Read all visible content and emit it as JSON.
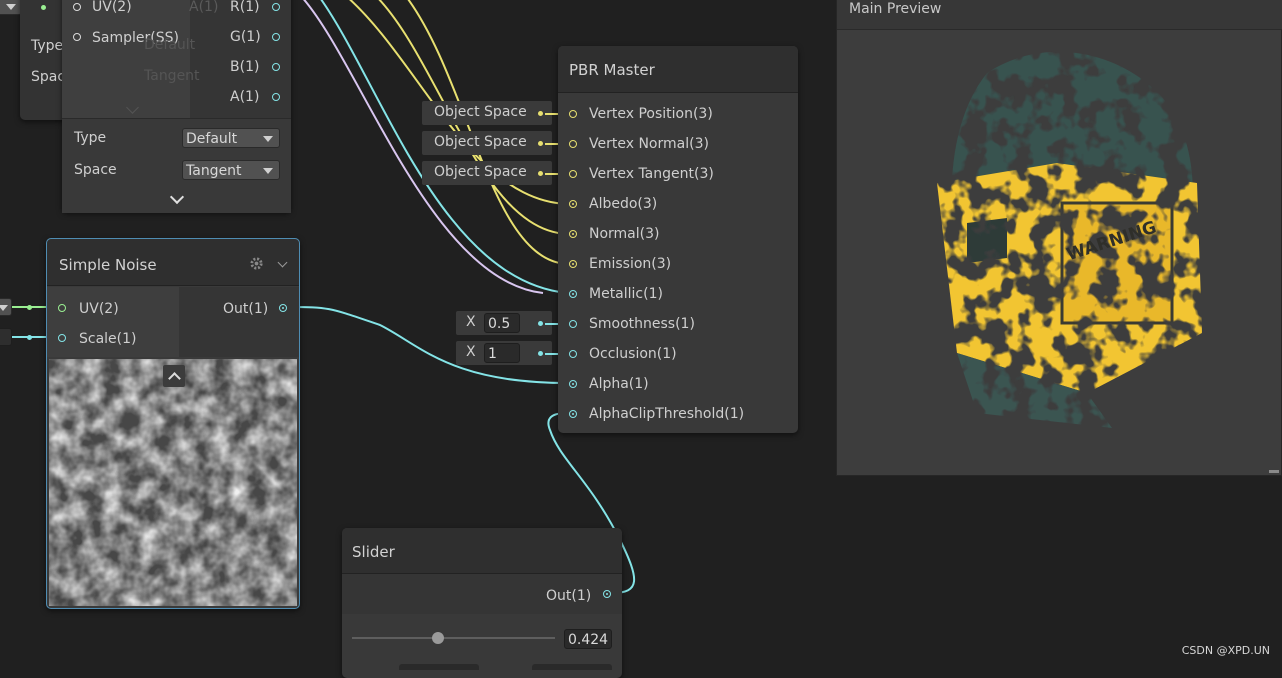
{
  "sample_texture_node": {
    "ports_in": [
      {
        "label": "UV(2)"
      },
      {
        "label": "Sampler(SS)"
      }
    ],
    "ports_out": [
      {
        "label": "A(1)"
      },
      {
        "label": "R(1)"
      },
      {
        "label": "G(1)"
      },
      {
        "label": "B(1)"
      },
      {
        "label": "A(1)"
      }
    ],
    "behind_type_label": "Type",
    "behind_space_label": "Space",
    "behind_type_value": "Default",
    "behind_space_value": "Tangent",
    "type_label": "Type",
    "type_value": "Default",
    "space_label": "Space",
    "space_value": "Tangent"
  },
  "simple_noise_node": {
    "title": "Simple Noise",
    "ports_in": [
      {
        "label": "UV(2)"
      },
      {
        "label": "Scale(1)"
      }
    ],
    "port_out": "Out(1)"
  },
  "pbr_master_node": {
    "title": "PBR Master",
    "ports": [
      {
        "label": "Vertex Position(3)",
        "color": "#e8e070"
      },
      {
        "label": "Vertex Normal(3)",
        "color": "#e8e070"
      },
      {
        "label": "Vertex Tangent(3)",
        "color": "#e8e070"
      },
      {
        "label": "Albedo(3)",
        "color": "#e8e070"
      },
      {
        "label": "Normal(3)",
        "color": "#e8e070"
      },
      {
        "label": "Emission(3)",
        "color": "#e8e070"
      },
      {
        "label": "Metallic(1)",
        "color": "#84e4e7"
      },
      {
        "label": "Smoothness(1)",
        "color": "#84e4e7"
      },
      {
        "label": "Occlusion(1)",
        "color": "#84e4e7"
      },
      {
        "label": "Alpha(1)",
        "color": "#84e4e7"
      },
      {
        "label": "AlphaClipThreshold(1)",
        "color": "#84e4e7"
      }
    ],
    "inline_inputs": [
      {
        "label": "Object Space"
      },
      {
        "label": "Object Space"
      },
      {
        "label": "Object Space"
      }
    ],
    "smoothness_axis": "X",
    "smoothness_value": "0.5",
    "occlusion_axis": "X",
    "occlusion_value": "1"
  },
  "slider_node": {
    "title": "Slider",
    "port_out": "Out(1)",
    "value_text": "0.424",
    "value": 0.424
  },
  "main_preview": {
    "title": "Main Preview",
    "sign_text": "WARNING"
  },
  "watermark": "CSDN @XPD.UN",
  "colors": {
    "vector1": "#84e4e7",
    "vector3": "#e8e070",
    "vector4": "#fbcbf4",
    "vector2": "#9aef92"
  }
}
